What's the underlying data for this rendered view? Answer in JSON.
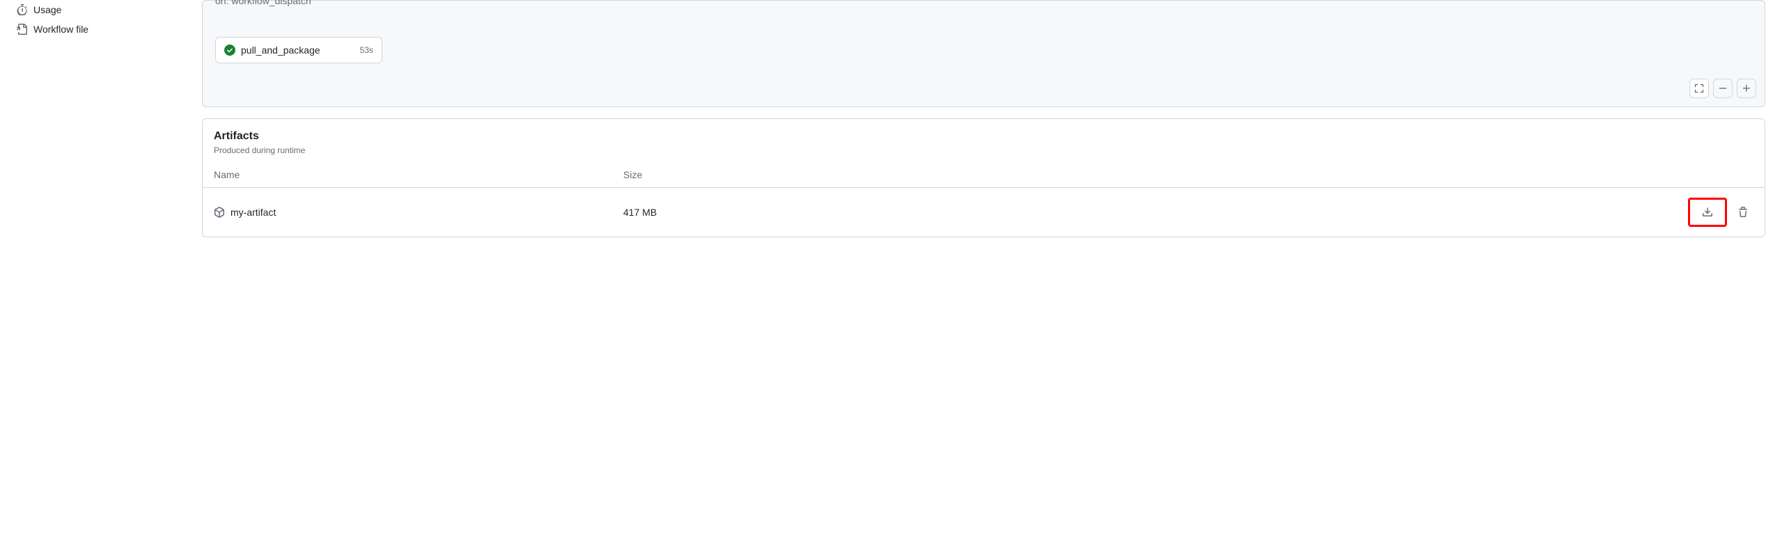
{
  "sidebar": {
    "items": [
      {
        "label": "Usage"
      },
      {
        "label": "Workflow file"
      }
    ]
  },
  "workflow_graph": {
    "trigger": "on: workflow_dispatch",
    "jobs": [
      {
        "name": "pull_and_package",
        "duration": "53s",
        "status": "success"
      }
    ]
  },
  "artifacts": {
    "title": "Artifacts",
    "subtitle": "Produced during runtime",
    "columns": {
      "name": "Name",
      "size": "Size"
    },
    "items": [
      {
        "name": "my-artifact",
        "size": "417 MB"
      }
    ]
  }
}
